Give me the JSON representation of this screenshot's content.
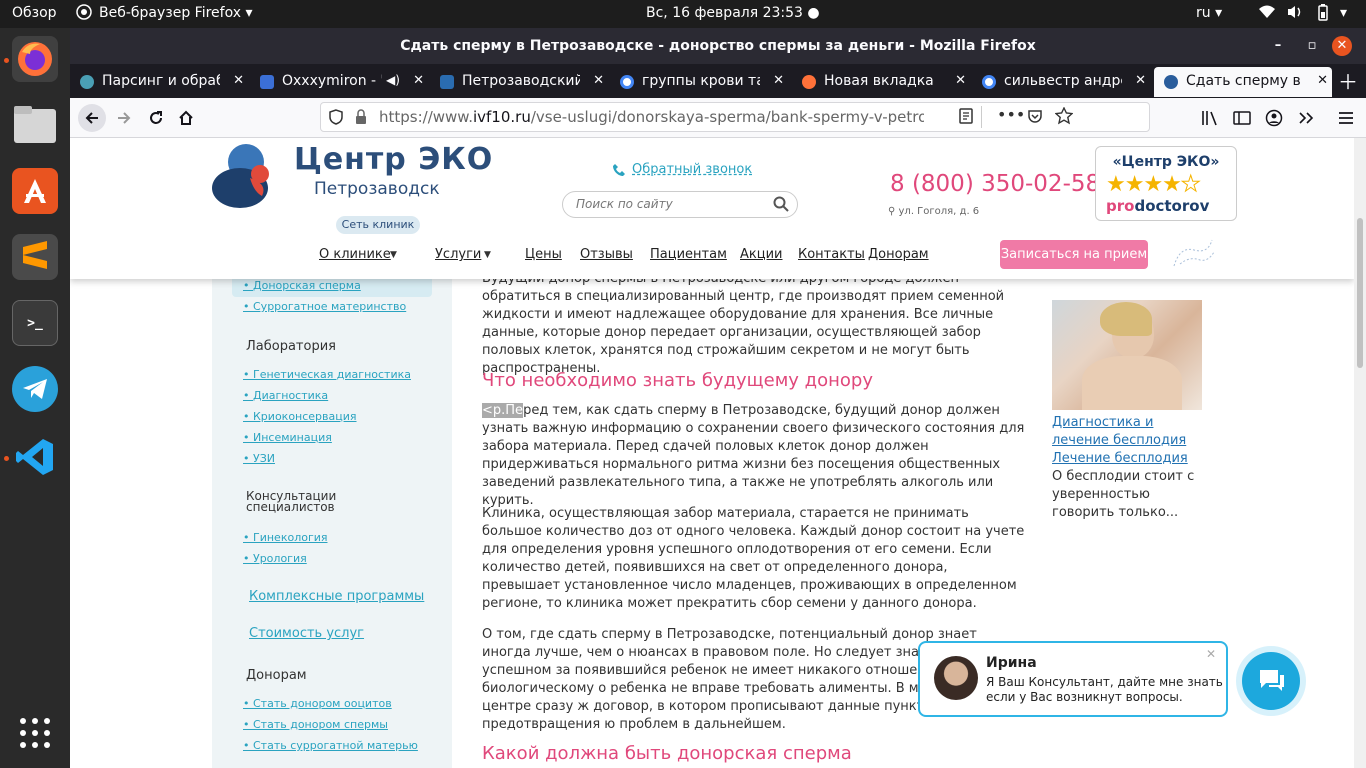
{
  "system": {
    "overview": "Обзор",
    "app_name": "Веб-браузер Firefox",
    "datetime": "Вс, 16 февраля  23:53",
    "lang": "ru"
  },
  "dock": {
    "items": [
      "firefox-icon",
      "files-icon",
      "software-center-icon",
      "sublime-text-icon",
      "terminal-icon",
      "telegram-icon",
      "vscode-icon",
      "app-grid-icon"
    ]
  },
  "window": {
    "title": "Сдать сперму в Петрозаводске - донорство спермы за деньги - Mozilla Firefox"
  },
  "tabs": [
    {
      "title": "Парсинг и обработка",
      "color": "#4a9fb5"
    },
    {
      "title": "Oxxxymiron - \"К",
      "color": "#3b6fd6"
    },
    {
      "title": "Петрозаводский",
      "color": "#2a6cb0"
    },
    {
      "title": "группы крови таб",
      "color": "#ffffff"
    },
    {
      "title": "Новая вкладка",
      "color": "#ff7139"
    },
    {
      "title": "сильвестр андре",
      "color": "#ffffff"
    },
    {
      "title": "Сдать сперму в Пе",
      "color": "#2a5d9c"
    }
  ],
  "navbar": {
    "url_prefix": "https://www.",
    "url_domain": "ivf10.ru",
    "url_path": "/vse-uslugi/donorskaya-sperma/bank-spermy-v-petrozavodske/"
  },
  "site": {
    "logo_title": "Центр ЭКО",
    "logo_city": "Петрозаводск",
    "network_btn": "Сеть клиник",
    "callback": "Обратный звонок",
    "search_placeholder": "Поиск по сайту",
    "phone": "8 (800) 350-02-58",
    "address": "ул. Гоголя, д. 6",
    "rating_title": "«Центр ЭКО»",
    "rating_brand_pro": "pro",
    "rating_brand_rest": "doctorov",
    "rating_stars": 4,
    "appointment_btn": "Записаться на прием",
    "menu": [
      "О клинике",
      "Услуги",
      "Цены",
      "Отзывы",
      "Пациентам",
      "Акции",
      "Контакты",
      "Донорам"
    ]
  },
  "sidebar": {
    "top_links": [
      "Донорская сперма",
      "Суррогатное материнство"
    ],
    "lab_title": "Лаборатория",
    "lab_links": [
      "Генетическая диагностика",
      "Диагностика",
      "Криоконсервация",
      "Инсеминация",
      "УЗИ"
    ],
    "consult_title": "Консультации специалистов",
    "consult_links": [
      "Гинекология",
      "Урология"
    ],
    "complex": "Комплексные программы",
    "cost": "Стоимость услуг",
    "donors_title": "Донорам",
    "donors_links": [
      "Стать донором ооцитов",
      "Стать донором спермы",
      "Стать суррогатной матерью"
    ]
  },
  "content": {
    "p1": "Будущий донор спермы в Петрозаводске или другом городе должен обратиться в специализированный центр, где производят прием семенной жидкости и имеют надлежащее оборудование для хранения. Все личные данные, которые донор передает организации, осуществляющей забор половых клеток, хранятся под строжайшим секретом и не могут быть распространены.",
    "h1": "Что необходимо знать будущему донору",
    "p2_tag": "<p.Пе",
    "p2": "ред тем, как сдать сперму в Петрозаводске, будущий донор должен узнать важную информацию о сохранении своего физического состояния для забора материала. Перед сдачей половых клеток донор должен придерживаться нормального ритма жизни без посещения общественных заведений развлекательного типа, а также не употреблять алкоголь или курить.",
    "p3": "Клиника, осуществляющая забор материала, старается не принимать большое количество доз от одного человека. Каждый донор состоит на учете для определения уровня успешного оплодотворения от его семени. Если количество детей, появившихся на свет от определенного донора, превышает установленное число младенцев, проживающих в определенном регионе, то клиника может прекратить сбор семени у данного донора.",
    "p4": "О том, где сдать сперму в Петрозаводске, потенциальный донор знает иногда лучше, чем о нюансах в правовом поле. Но следует знать, что при успешном за появившийся ребенок не имеет никакого отношения к биологическому о ребенка не вправе требовать алименты. В медицинском центре сразу ж договор, в котором прописывают данные пункты для предотвращения ю проблем в дальнейшем.",
    "h2": "Какой должна быть донорская сперма"
  },
  "aside": {
    "link1": "Диагностика и лечение бесплодия",
    "link2": "Лечение бесплодия",
    "text": "О бесплодии стоит с уверенностью говорить только..."
  },
  "chat": {
    "name": "Ирина",
    "message": "Я Ваш Консультант, дайте мне знать если у Вас возникнут вопросы."
  }
}
